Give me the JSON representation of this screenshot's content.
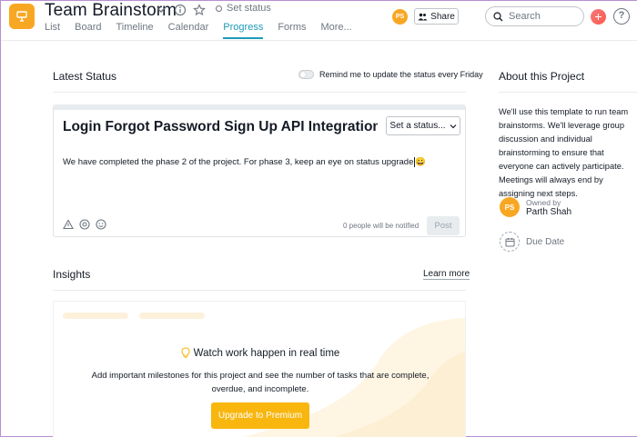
{
  "header": {
    "project_title": "Team Brainstorm",
    "set_status": "Set status",
    "tabs": [
      {
        "label": "List"
      },
      {
        "label": "Board"
      },
      {
        "label": "Timeline"
      },
      {
        "label": "Calendar"
      },
      {
        "label": "Progress",
        "active": true
      },
      {
        "label": "Forms"
      },
      {
        "label": "More..."
      }
    ],
    "user_initials": "PS",
    "share_label": "Share",
    "search_placeholder": "Search",
    "plus_label": "+",
    "help_label": "?"
  },
  "latest_status": {
    "title": "Latest Status",
    "remind_label": "Remind me to update the status every Friday",
    "card": {
      "status_title": "Login Forgot Password Sign Up API Integration Com",
      "set_status_btn": "Set a status...",
      "body": "We have completed the phase 2 of the project. For phase 3, keep an eye on status upgrade",
      "emoji": "😀",
      "notified": "0 people will be notified",
      "post_label": "Post"
    }
  },
  "insights": {
    "title": "Insights",
    "learn_more": "Learn more",
    "headline": "Watch work happen in real time",
    "text": "Add important milestones for this project and see the number of tasks that are complete, overdue, and incomplete.",
    "upgrade_label": "Upgrade to Premium"
  },
  "about": {
    "title": "About this Project",
    "description": "We'll use this template to run team brainstorms. We'll leverage group discussion and individual brainstorming to ensure that everyone can actively participate. Meetings will always end by assigning next steps.",
    "owner_initials": "PS",
    "owned_by_label": "Owned by",
    "owner_name": "Parth Shah",
    "due_date_label": "Due Date"
  },
  "colors": {
    "accent_tab": "#1f9bb8",
    "project_icon": "#f8a723",
    "upgrade_button": "#f8b60e",
    "plus_button": "#f95b4b"
  }
}
